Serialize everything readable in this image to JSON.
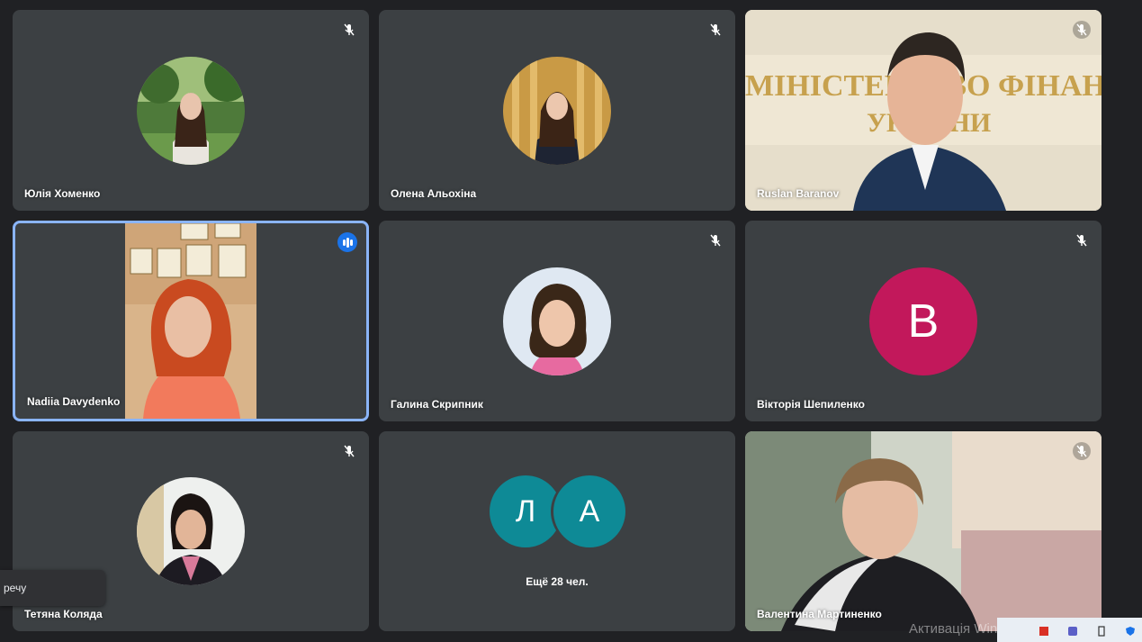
{
  "participants": [
    {
      "name": "Юлія Хоменко",
      "muted": true
    },
    {
      "name": "Олена Альохіна",
      "muted": true
    },
    {
      "name": "Ruslan Baranov",
      "muted": true
    },
    {
      "name": "Nadiia Davydenko",
      "muted": false,
      "speaking": true
    },
    {
      "name": "Галина Скрипник",
      "muted": true
    },
    {
      "name": "Вікторія Шепиленко",
      "muted": true,
      "initial": "В",
      "avatar_color": "#c2185b"
    },
    {
      "name": "Тетяна Коляда",
      "muted": true
    },
    {
      "name": "Валентина Мартиненко",
      "muted": true
    }
  ],
  "more_tile": {
    "initials": [
      "Л",
      "А"
    ],
    "avatar_color": "#0e8a96",
    "label": "Ещё 28 чел."
  },
  "background_text": {
    "line1": "МІНІСТЕРСТВО ФІНАНСІВ",
    "line2": "УКРАЇНИ"
  },
  "tooltip": {
    "text": "речу"
  },
  "os_watermark": {
    "text": "Активація Windows"
  },
  "colors": {
    "app_background": "#202124",
    "tile_background": "#3c4043",
    "active_border": "#8ab4f8",
    "speaking_badge": "#1a73e8"
  },
  "icons": {
    "muted": "mic-off-icon",
    "speaking": "audio-level-icon",
    "tray": [
      "pdf-icon",
      "teams-icon",
      "usb-icon",
      "security-shield-icon"
    ]
  }
}
